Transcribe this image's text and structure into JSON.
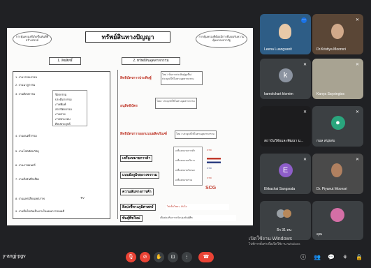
{
  "meeting": {
    "code": "y-angj-pgv"
  },
  "slide": {
    "title": "ทรัพย์สินทางปัญญา",
    "note_left": "การคุ้มครองที่เกิดขึ้นทันทีที่สร้างสรรค์",
    "note_right": "การคุ้มครองที่ต้องมีการยื่นขอรับความคุ้มครองจากรัฐ",
    "col1_header": "1. ลิขสิทธิ์",
    "col2_header": "2. ทรัพย์สินอุตสาหกรรม",
    "col1_items": [
      "1. งานวรรณกรรม",
      "2. งานนาฏกรรม",
      "3. งานศิลปกรรม",
      "4. งานดนตรีกรรม",
      "5. งานโสตทัศนวัสดุ",
      "6. งานภาพยนตร์",
      "7. งานสิ่งบันทึกเสียง",
      "8. งานแพร่เสียงแพร่ภาพ",
      "9. งานอื่นใดอันเป็นงานในแผนกวรรณคดี"
    ],
    "art_sub": [
      "จิตรกรรม",
      "ประติมากรรม",
      "ภาพพิมพ์",
      "สถาปัตยกรรม",
      "ภาพถ่าย",
      "ภาพประกอบ",
      "ศิลปประยุกต์"
    ],
    "tv_label": "TV",
    "col2_items": [
      "สิทธิบัตรการประดิษฐ์",
      "อนุสิทธิบัตร",
      "สิทธิบัตรการออกแบบผลิตภัณฑ์",
      "เครื่องหมายการค้า",
      "แบบผังภูมิของวงจรรวม",
      "ความลับทางการค้า",
      "สิ่งบ่งชี้ทางภูมิศาสตร์",
      "พันธุ์พืชใหม่"
    ],
    "item_notes": [
      "ใหม่ / ขั้นการประดิษฐ์สูงขึ้น / ประยุกต์ใช้ในทางอุตสาหกรรม",
      "ใหม่ / ประยุกต์ใช้ในทางอุตสาหกรรม",
      "ใหม่ / ประยุกต์ใช้ในทางอุตสาหกรรม",
      "",
      "",
      "",
      "ไข่เค็มไชยา, ส้มโอ",
      "เพื่อส่งเสริมการปรับปรุงพันธุ์พืช"
    ],
    "trademark_types": [
      "เครื่องหมายการค้า",
      "เครื่องหมายบริการ",
      "เครื่องหมายรับรอง",
      "เครื่องหมายร่วม"
    ],
    "trademark_logos": [
      "ภาพ",
      "ภาพ",
      "ภาพ",
      "SCG"
    ]
  },
  "participants": [
    {
      "name": "Leena Luangsanit",
      "kind": "video",
      "color": "#2e5d86"
    },
    {
      "name": "Dr.Kristiya Moonsri",
      "kind": "video",
      "color": "#5a4636"
    },
    {
      "name": "kamolchart klomim",
      "kind": "letter",
      "letter": "k",
      "color": "#8b93a0"
    },
    {
      "name": "Kanya Saysingtos",
      "kind": "video",
      "color": "#a8a392"
    },
    {
      "name": "สถาบันวิจัยและพัฒนา ม...",
      "kind": "video",
      "color": "#1c1c1e"
    },
    {
      "name": "กมล สนุ่ยสบ",
      "kind": "icon",
      "color": "#2aa57d"
    },
    {
      "name": "Ekkachai Sangsoda",
      "kind": "letter",
      "letter": "E",
      "color": "#8e5ec9"
    },
    {
      "name": "Dr. Piyanut Moonsri",
      "kind": "video",
      "color": "#4a4a4a"
    },
    {
      "name": "อีก 31 คน",
      "kind": "group",
      "color": "#3c4043"
    },
    {
      "name": "คุณ",
      "kind": "self",
      "color": "#d46fa6"
    }
  ],
  "windows": {
    "activate": "เปิดใช้งาน Windows",
    "hint": "ไปที่การตั้งค่าเพื่อเปิดใช้งาน Windows"
  },
  "controls": {
    "mic_icon": "microphone-off-icon",
    "cam_icon": "camera-off-icon",
    "hand_icon": "raise-hand-icon",
    "present_icon": "present-screen-icon",
    "more_icon": "more-options-icon",
    "leave_icon": "end-call-icon",
    "colors": {
      "red": "#ea4335",
      "grey": "#3c4043"
    }
  }
}
